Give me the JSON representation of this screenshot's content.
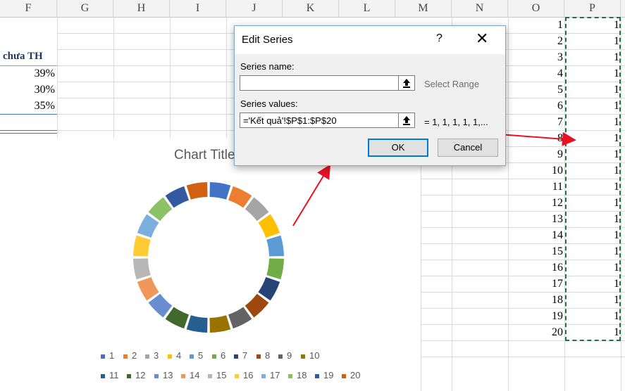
{
  "columns": [
    "F",
    "G",
    "H",
    "I",
    "J",
    "K",
    "L",
    "M",
    "N",
    "O",
    "P"
  ],
  "cells": {
    "header_text": "chưa TH",
    "percents": [
      "39%",
      "30%",
      "35%"
    ]
  },
  "column_o": [
    "1",
    "2",
    "3",
    "4",
    "5",
    "6",
    "7",
    "8",
    "9",
    "10",
    "11",
    "12",
    "13",
    "14",
    "15",
    "16",
    "17",
    "18",
    "19",
    "20"
  ],
  "column_p": [
    "1",
    "1",
    "1",
    "1",
    "1",
    "1",
    "1",
    "1",
    "1",
    "1",
    "1",
    "1",
    "1",
    "1",
    "1",
    "1",
    "1",
    "1",
    "1",
    "1"
  ],
  "chart": {
    "title": "Chart Title",
    "legend": [
      "1",
      "2",
      "3",
      "4",
      "5",
      "6",
      "7",
      "8",
      "9",
      "10",
      "11",
      "12",
      "13",
      "14",
      "15",
      "16",
      "17",
      "18",
      "19",
      "20"
    ]
  },
  "dialog": {
    "title": "Edit Series",
    "help": "?",
    "series_name_label": "Series name:",
    "series_name_value": "",
    "select_range": "Select Range",
    "series_values_label": "Series values:",
    "series_values_value": "='Kết quả'!$P$1:$P$20",
    "preview": "= 1, 1, 1, 1, 1,...",
    "ok": "OK",
    "cancel": "Cancel"
  },
  "chart_data": {
    "type": "pie",
    "categories": [
      "1",
      "2",
      "3",
      "4",
      "5",
      "6",
      "7",
      "8",
      "9",
      "10",
      "11",
      "12",
      "13",
      "14",
      "15",
      "16",
      "17",
      "18",
      "19",
      "20"
    ],
    "values": [
      1,
      1,
      1,
      1,
      1,
      1,
      1,
      1,
      1,
      1,
      1,
      1,
      1,
      1,
      1,
      1,
      1,
      1,
      1,
      1
    ],
    "title": "Chart Title",
    "legend": "bottom"
  },
  "colors": {
    "palette": [
      "#4472c4",
      "#ed7d31",
      "#a5a5a5",
      "#ffc000",
      "#5b9bd5",
      "#70ad47",
      "#264478",
      "#9e480e",
      "#636363",
      "#997300",
      "#255e91",
      "#43682b",
      "#698ed0",
      "#f1975a",
      "#b7b7b7",
      "#ffcd33",
      "#7cafdd",
      "#8cc168",
      "#335aa1",
      "#d26012"
    ]
  }
}
